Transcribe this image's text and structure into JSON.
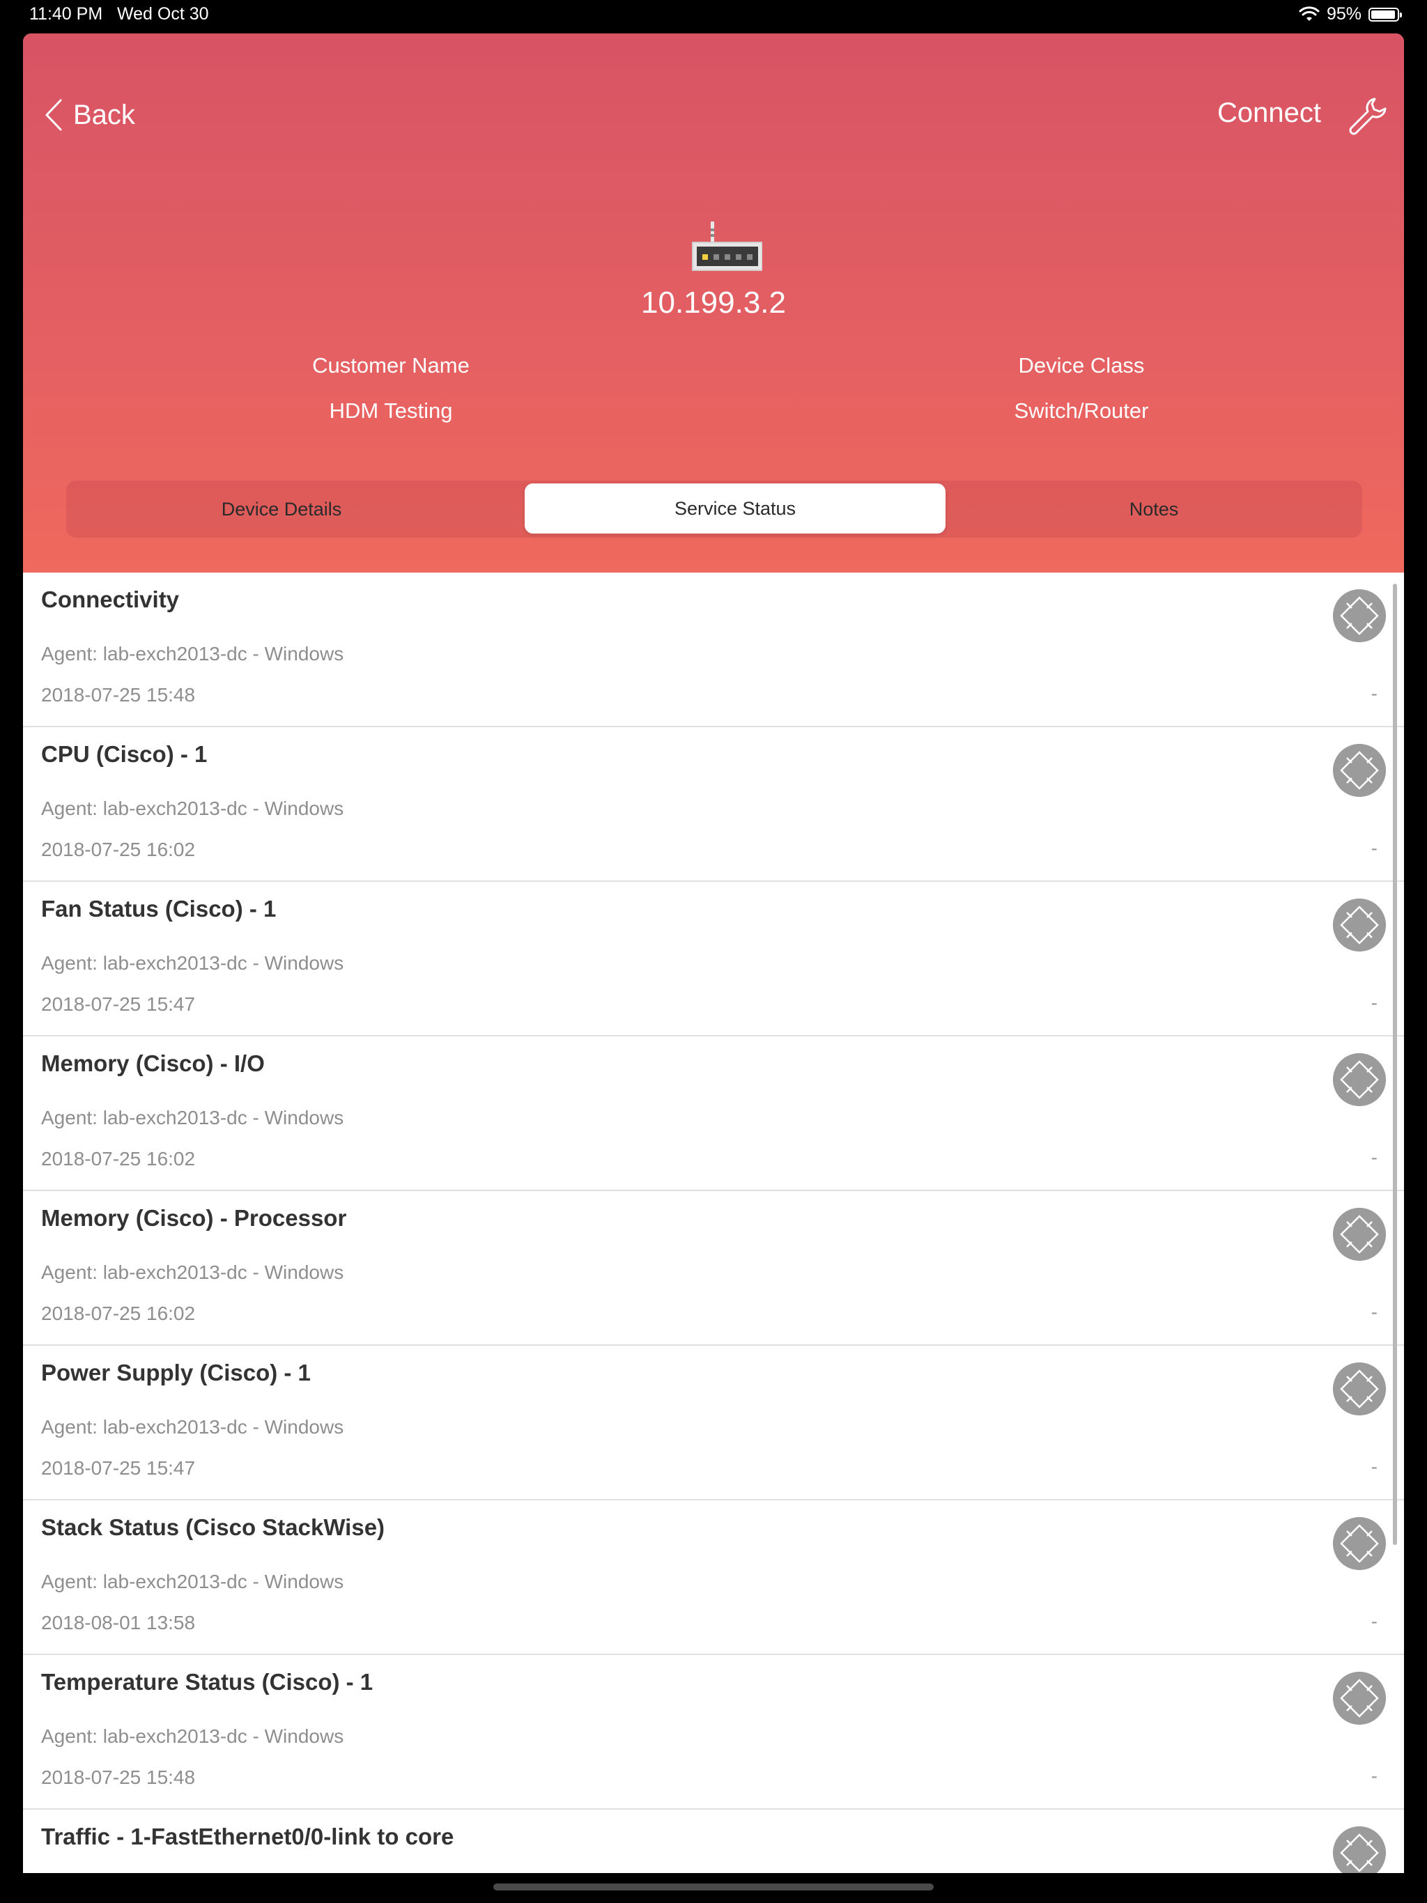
{
  "status_bar": {
    "time": "11:40 PM",
    "date": "Wed Oct 30",
    "battery": "95%",
    "battery_level": 0.95
  },
  "header": {
    "back_label": "Back",
    "connect_label": "Connect",
    "ip": "10.199.3.2",
    "customer_label": "Customer Name",
    "customer_value": "HDM Testing",
    "class_label": "Device Class",
    "class_value": "Switch/Router",
    "colors": {
      "top": "#d85465",
      "bottom": "#f0695e"
    }
  },
  "tabs": [
    {
      "label": "Device Details",
      "active": false
    },
    {
      "label": "Service Status",
      "active": true
    },
    {
      "label": "Notes",
      "active": false
    }
  ],
  "services": [
    {
      "title": "Connectivity",
      "agent": "Agent: lab-exch2013-dc - Windows",
      "date": "2018-07-25 15:48",
      "value": "-"
    },
    {
      "title": "CPU (Cisco) - 1",
      "agent": "Agent: lab-exch2013-dc - Windows",
      "date": "2018-07-25 16:02",
      "value": "-"
    },
    {
      "title": "Fan Status (Cisco) - 1",
      "agent": "Agent: lab-exch2013-dc - Windows",
      "date": "2018-07-25 15:47",
      "value": "-"
    },
    {
      "title": "Memory (Cisco) - I/O",
      "agent": "Agent: lab-exch2013-dc - Windows",
      "date": "2018-07-25 16:02",
      "value": "-"
    },
    {
      "title": "Memory (Cisco) - Processor",
      "agent": "Agent: lab-exch2013-dc - Windows",
      "date": "2018-07-25 16:02",
      "value": "-"
    },
    {
      "title": "Power Supply (Cisco) - 1",
      "agent": "Agent: lab-exch2013-dc - Windows",
      "date": "2018-07-25 15:47",
      "value": "-"
    },
    {
      "title": "Stack Status (Cisco StackWise)",
      "agent": "Agent: lab-exch2013-dc - Windows",
      "date": "2018-08-01 13:58",
      "value": "-"
    },
    {
      "title": "Temperature Status (Cisco) - 1",
      "agent": "Agent: lab-exch2013-dc - Windows",
      "date": "2018-07-25 15:48",
      "value": "-"
    },
    {
      "title": "Traffic - 1-FastEthernet0/0-link to core",
      "agent": "",
      "date": "",
      "value": ""
    }
  ]
}
